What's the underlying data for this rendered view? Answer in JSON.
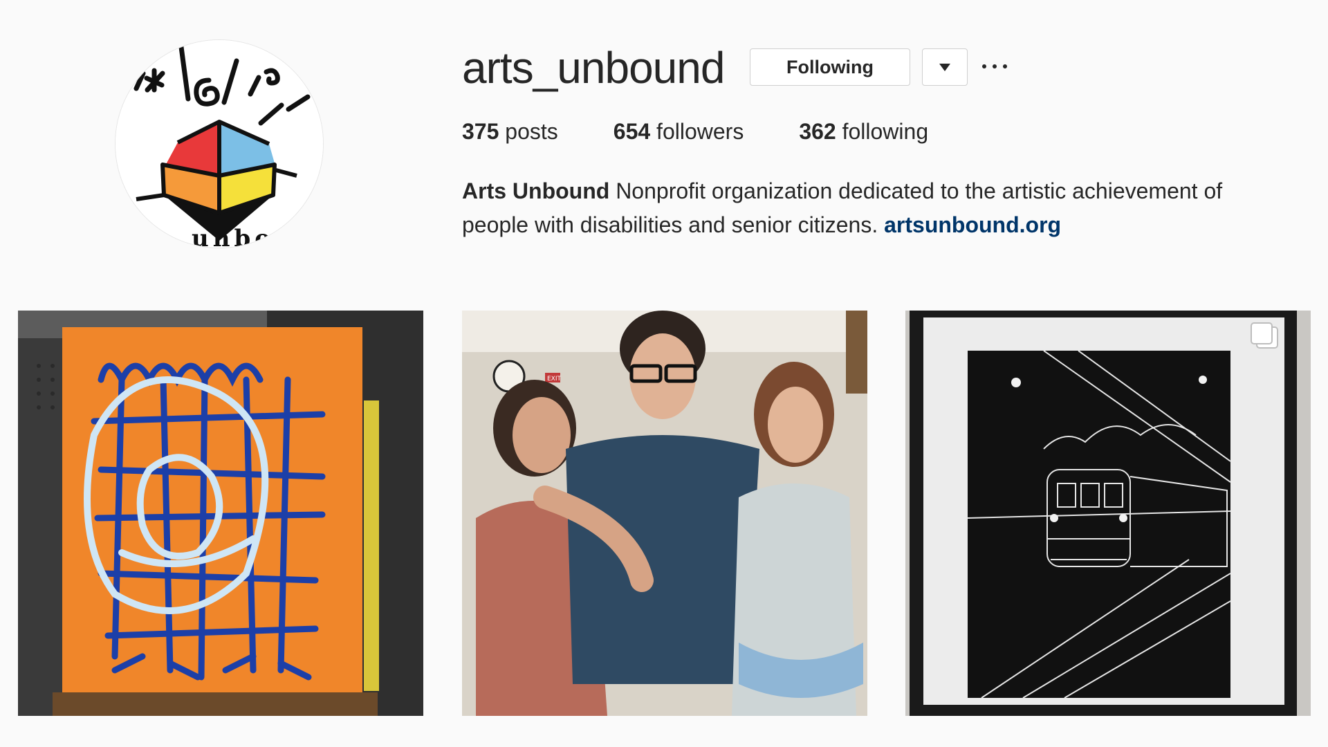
{
  "profile": {
    "username": "arts_unbound",
    "avatar_text": "unbo",
    "following_label": "Following",
    "stats": [
      {
        "count": "375",
        "label": "posts"
      },
      {
        "count": "654",
        "label": "followers"
      },
      {
        "count": "362",
        "label": "following"
      }
    ],
    "bio": {
      "name": "Arts Unbound",
      "text": "Nonprofit organization dedicated to the artistic achievement of people with disabilities and senior citizens.",
      "link": "artsunbound.org"
    }
  },
  "icons": {
    "dropdown": "chevron-down-icon",
    "more": "more-options-icon",
    "multi_post": "multiple-images-icon"
  },
  "posts": [
    {
      "subject": "painting-icon"
    },
    {
      "subject": "photo-icon"
    },
    {
      "subject": "train-drawing-icon",
      "exit_sign": "EXIT"
    }
  ],
  "colors": {
    "background": "#fafafa",
    "text": "#262626",
    "link": "#003569",
    "button_border": "#cfcfcf"
  }
}
